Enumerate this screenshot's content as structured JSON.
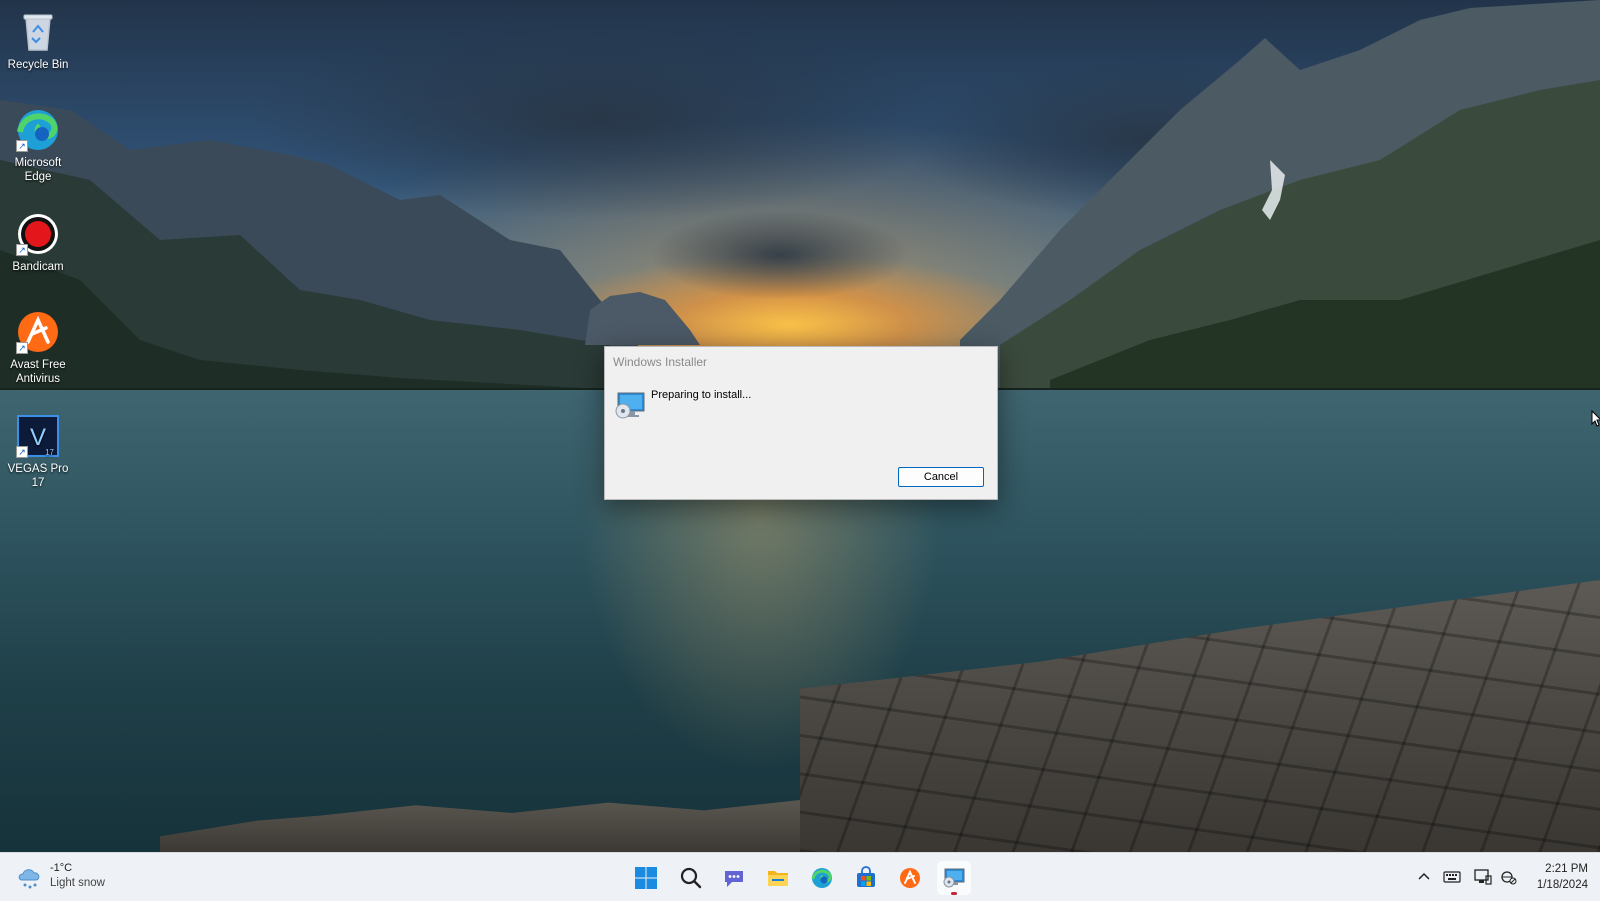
{
  "desktop": {
    "icons": [
      {
        "label": "Recycle Bin",
        "icon": "recycle-bin-icon"
      },
      {
        "label": "Microsoft Edge",
        "icon": "edge-icon"
      },
      {
        "label": "Bandicam",
        "icon": "bandicam-icon"
      },
      {
        "label": "Avast Free Antivirus",
        "icon": "avast-icon"
      },
      {
        "label": "VEGAS Pro 17",
        "icon": "vegas-icon"
      }
    ]
  },
  "dialog": {
    "title": "Windows Installer",
    "message": "Preparing to install...",
    "cancel_label": "Cancel",
    "icon": "installer-icon"
  },
  "taskbar": {
    "weather": {
      "temp": "-1°C",
      "condition": "Light snow",
      "icon": "snow-cloud-icon"
    },
    "apps": [
      {
        "name": "start",
        "icon": "windows-start-icon"
      },
      {
        "name": "search",
        "icon": "search-icon"
      },
      {
        "name": "chat",
        "icon": "teams-chat-icon"
      },
      {
        "name": "file-explorer",
        "icon": "folder-icon"
      },
      {
        "name": "edge",
        "icon": "edge-icon"
      },
      {
        "name": "store",
        "icon": "store-icon"
      },
      {
        "name": "avast",
        "icon": "avast-icon"
      },
      {
        "name": "windows-installer",
        "icon": "installer-icon",
        "active": true
      }
    ],
    "tray": {
      "icons": [
        "chevron-up-icon",
        "keyboard-icon",
        "display-icon",
        "network-icon"
      ],
      "time": "2:21 PM",
      "date": "1/18/2024"
    }
  },
  "colors": {
    "accent": "#0067c0",
    "taskbar": "#eef1f5",
    "dialog": "#f0f0f0"
  }
}
